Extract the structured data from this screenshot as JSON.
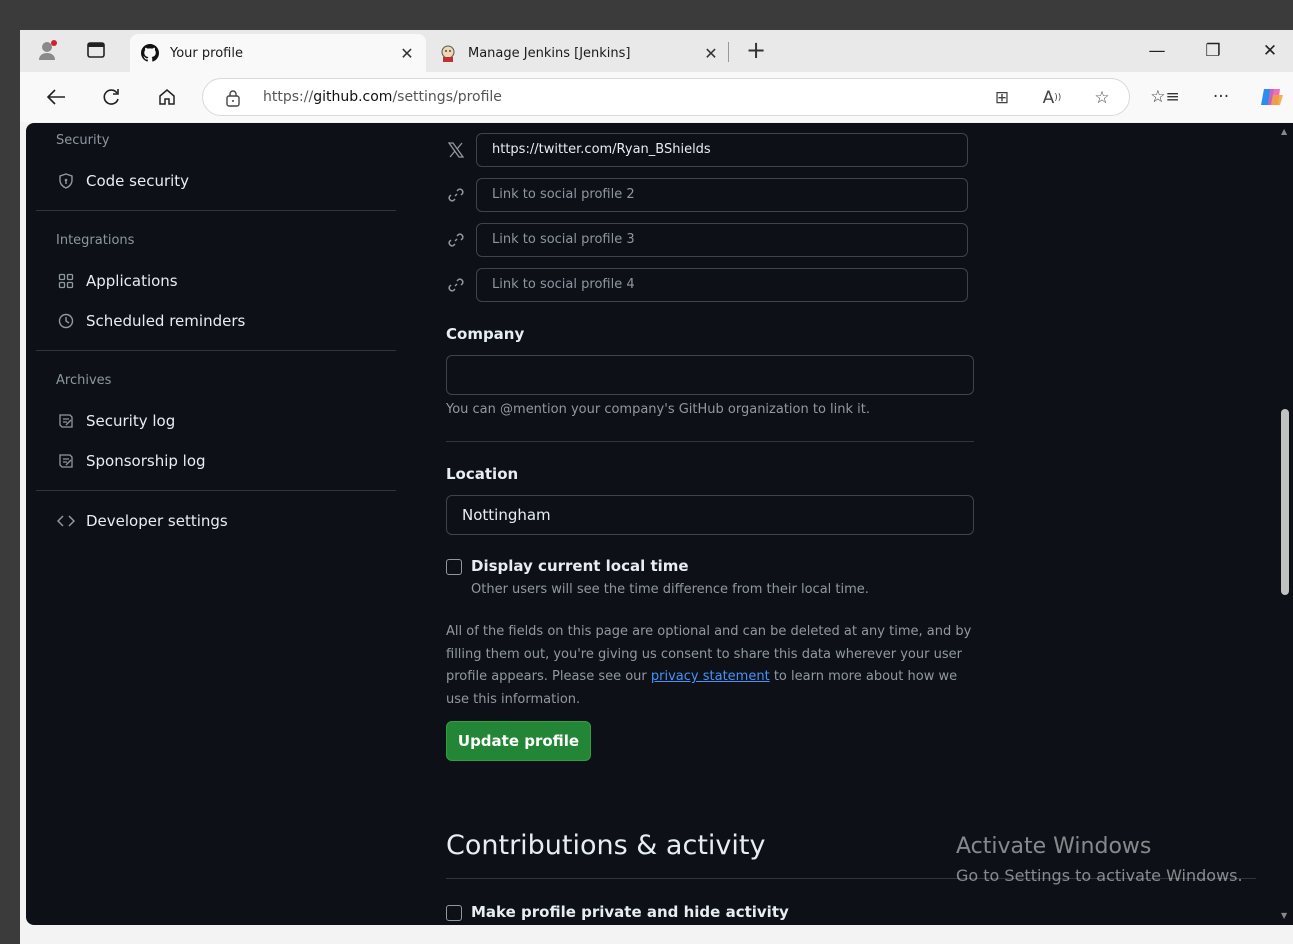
{
  "tabs": [
    {
      "title": "Your profile",
      "active": true,
      "icon": "github-icon"
    },
    {
      "title": "Manage Jenkins [Jenkins]",
      "active": false,
      "icon": "jenkins-icon"
    }
  ],
  "window_controls": {
    "minimize": "—",
    "restore": "❐",
    "close": "✕"
  },
  "address_bar": {
    "url_prefix": "https://",
    "url_domain": "github.com",
    "url_path": "/settings/profile"
  },
  "sidebar": {
    "security_header": "Security",
    "code_security": "Code security",
    "integrations_header": "Integrations",
    "applications": "Applications",
    "scheduled_reminders": "Scheduled reminders",
    "archives_header": "Archives",
    "security_log": "Security log",
    "sponsorship_log": "Sponsorship log",
    "developer_settings": "Developer settings"
  },
  "social": {
    "link1_value": "https://twitter.com/Ryan_BShields",
    "link2_placeholder": "Link to social profile 2",
    "link3_placeholder": "Link to social profile 3",
    "link4_placeholder": "Link to social profile 4"
  },
  "company": {
    "label": "Company",
    "value": "",
    "note": "You can @mention your company's GitHub organization to link it."
  },
  "location": {
    "label": "Location",
    "value": "Nottingham"
  },
  "local_time": {
    "label": "Display current local time",
    "note": "Other users will see the time difference from their local time.",
    "checked": false
  },
  "consent": {
    "text_before": "All of the fields on this page are optional and can be deleted at any time, and by filling them out, you're giving us consent to share this data wherever your user profile appears. Please see our ",
    "link": "privacy statement",
    "text_after": " to learn more about how we use this information."
  },
  "update_button": "Update profile",
  "contributions": {
    "title": "Contributions & activity",
    "private_label": "Make profile private and hide activity"
  },
  "watermark": {
    "line1": "Activate Windows",
    "line2": "Go to Settings to activate Windows."
  },
  "colors": {
    "accent_green": "#238636",
    "link_blue": "#4493f8",
    "page_bg": "#0d1117"
  }
}
